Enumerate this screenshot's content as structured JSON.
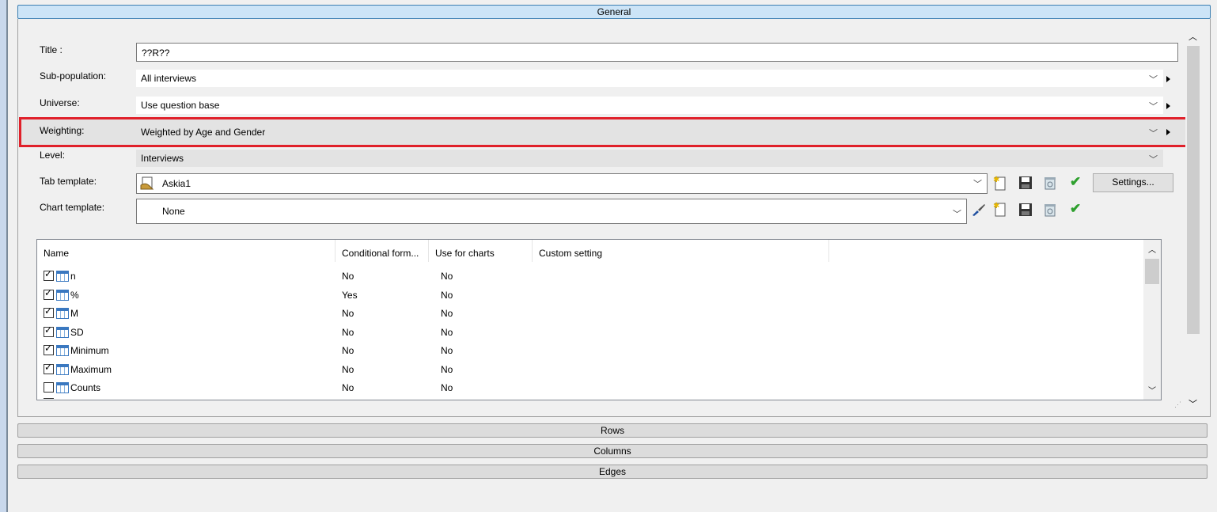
{
  "sections": {
    "general": "General",
    "rows": "Rows",
    "columns": "Columns",
    "edges": "Edges"
  },
  "form": {
    "title_label": "Title :",
    "title_value": "??R??",
    "subpop_label": "Sub-population:",
    "subpop_value": "All interviews",
    "universe_label": "Universe:",
    "universe_value": "Use question base",
    "weighting_label": "Weighting:",
    "weighting_value": "Weighted by Age and Gender",
    "level_label": "Level:",
    "level_value": "Interviews",
    "tab_template_label": "Tab template:",
    "tab_template_value": "Askia1",
    "chart_template_label": "Chart template:",
    "chart_template_value": "None",
    "settings_label": "Settings..."
  },
  "grid": {
    "headers": [
      "Name",
      "Conditional form...",
      "Use for charts",
      "Custom setting"
    ],
    "rows": [
      {
        "name": "n",
        "checked": true,
        "cond": "No",
        "charts": "No"
      },
      {
        "name": "%",
        "checked": true,
        "cond": "Yes",
        "charts": "No"
      },
      {
        "name": "M",
        "checked": true,
        "cond": "No",
        "charts": "No"
      },
      {
        "name": "SD",
        "checked": true,
        "cond": "No",
        "charts": "No"
      },
      {
        "name": "Minimum",
        "checked": true,
        "cond": "No",
        "charts": "No"
      },
      {
        "name": "Maximum",
        "checked": true,
        "cond": "No",
        "charts": "No"
      },
      {
        "name": "Counts",
        "checked": false,
        "cond": "No",
        "charts": "No"
      }
    ]
  },
  "colors": {
    "highlight": "#e0202a",
    "active_header": "#cce4f7",
    "check_green": "#2ea02e"
  }
}
